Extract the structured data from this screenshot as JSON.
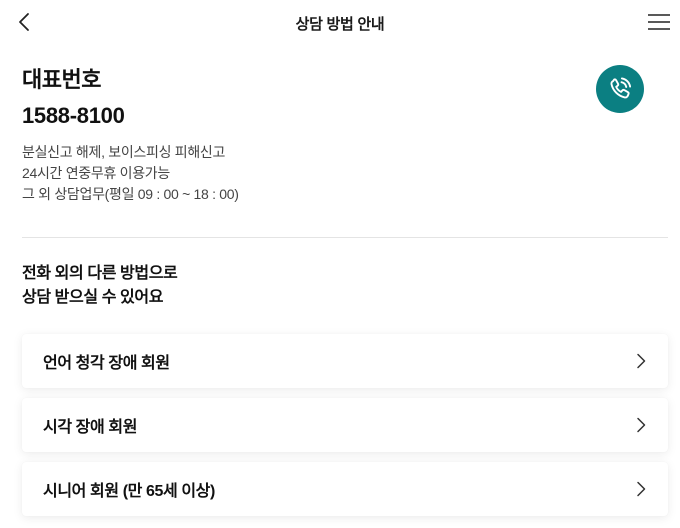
{
  "header": {
    "title": "상담 방법 안내",
    "back_icon": "chevron-left-icon",
    "menu_icon": "hamburger-menu-icon"
  },
  "representative": {
    "label": "대표번호",
    "number": "1588-8100",
    "descriptions": [
      "분실신고 해제, 보이스피싱 피해신고",
      "24시간 연중무휴 이용가능",
      "그 외 상담업무(평일 09 : 00 ~ 18 : 00)"
    ],
    "call_icon": "phone-call-icon",
    "call_color": "#0b7f82"
  },
  "alternatives": {
    "heading_lines": [
      "전화 외의 다른 방법으로",
      "상담 받으실 수 있어요"
    ],
    "options": [
      {
        "label": "언어 청각 장애 회원"
      },
      {
        "label": "시각 장애 회원"
      },
      {
        "label": "시니어 회원 (만 65세 이상)"
      }
    ]
  }
}
